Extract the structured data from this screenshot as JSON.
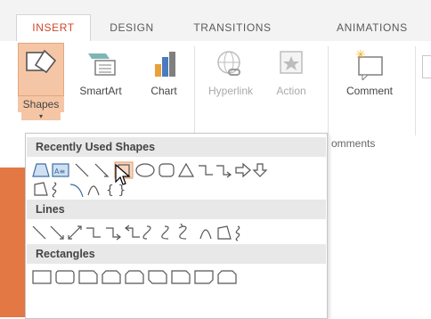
{
  "ribbon": {
    "tabs": [
      {
        "label": "INSERT",
        "active": true
      },
      {
        "label": "DESIGN",
        "active": false
      },
      {
        "label": "TRANSITIONS",
        "active": false
      },
      {
        "label": "ANIMATIONS",
        "active": false
      }
    ],
    "buttons": {
      "shapes": "Shapes",
      "smartart": "SmartArt",
      "chart": "Chart",
      "hyperlink": "Hyperlink",
      "action": "Action",
      "comment": "Comment"
    },
    "groups": {
      "comments": "omments"
    }
  },
  "shapes_menu": {
    "sections": [
      {
        "title": "Recently Used Shapes"
      },
      {
        "title": "Lines"
      },
      {
        "title": "Rectangles"
      }
    ]
  },
  "colors": {
    "accent": "#d24726",
    "shapes_button_bg": "#f5c6a5",
    "slide_orange": "#e37845",
    "section_header_bg": "#e8e8e8"
  }
}
